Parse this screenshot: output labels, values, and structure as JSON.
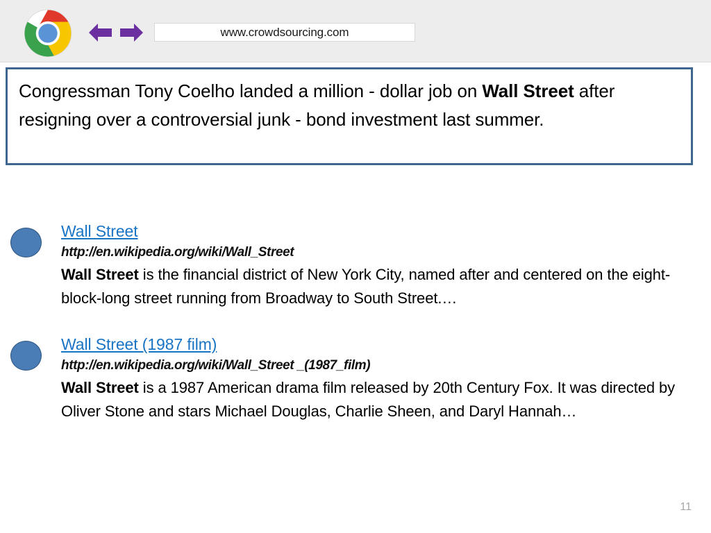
{
  "browser": {
    "logo_icon": "chrome-logo-icon",
    "back_icon": "arrow-left-icon",
    "forward_icon": "arrow-right-icon",
    "url_value": "www.crowdsourcing.com",
    "url_placeholder": "Search or type URL",
    "header_bg": "#ededed",
    "arrow_color": "#6b2fa0"
  },
  "query_box": {
    "border_color": "#3d6690",
    "text_part_1": "Congressman Tony Coelho landed a million - dollar job on ",
    "text_bold_1": "Wall Street",
    "text_part_2": " after resigning over a controversial junk - bond investment last summer."
  },
  "results": [
    {
      "bullet_icon": "blue-circle-bullet-icon",
      "title": "Wall Street",
      "url": "http://en.wikipedia.org/wiki/Wall_Street",
      "snippet_bold": "Wall Street",
      "snippet_rest": " is the financial district of New York City, named after and centered on the eight-block-long street running from Broadway to South Street.…"
    },
    {
      "bullet_icon": "blue-circle-bullet-icon",
      "title": "Wall Street (1987 film)",
      "url": "http://en.wikipedia.org/wiki/Wall_Street _(1987_film)",
      "snippet_bold": "Wall Street",
      "snippet_rest": " is a 1987 American drama film released by 20th Century Fox. It was directed by Oliver Stone and stars Michael Douglas, Charlie Sheen, and Daryl Hannah…"
    }
  ],
  "footer": {
    "page_number": "11"
  },
  "colors": {
    "link": "#1a74c4",
    "bullet": "#4a7cb5",
    "box_border": "#3d6690",
    "page_number": "#a6a6a6"
  }
}
